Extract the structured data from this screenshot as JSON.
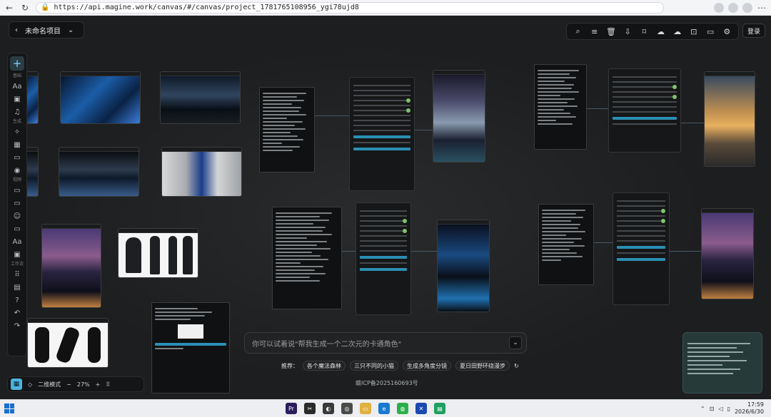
{
  "browser": {
    "url": "https://api.magine.work/canvas/#/canvas/project_1781765108956_ygi78ujd8"
  },
  "project": {
    "name": "未命名项目"
  },
  "topbar": {
    "login_label": "登录",
    "tools": [
      "search-icon",
      "list-icon",
      "trash-icon",
      "download-icon",
      "bookmark-icon",
      "cloud-upload-icon",
      "cloud-sync-icon",
      "export-icon",
      "folder-icon",
      "settings-icon"
    ]
  },
  "sidebar": {
    "sections": [
      {
        "label": "基础",
        "items": [
          "text-icon",
          "image-icon",
          "audio-icon"
        ]
      },
      {
        "label": "生成",
        "items": [
          "sparkle-icon",
          "frame-icon",
          "video-icon",
          "camera-icon"
        ]
      },
      {
        "label": "视频",
        "items": [
          "video-camera-icon",
          "video-icon",
          "people-icon",
          "film-icon",
          "text-icon",
          "image-edit-icon"
        ]
      },
      {
        "label": "工作流",
        "items": [
          "apps-icon",
          "save-icon",
          "help-icon",
          "undo-icon",
          "redo-icon"
        ]
      }
    ]
  },
  "chat": {
    "placeholder": "你可以试着说\"帮我生成一个二次元的卡通角色\"",
    "suggest_label": "推荐：",
    "suggestions": [
      "各个魔法森林",
      "三只不同的小猫",
      "生成多角度分镜",
      "夏日田野环绕漫步"
    ]
  },
  "icp_text": "赣ICP备2025160693号",
  "zoom": {
    "mode_label": "二维模式",
    "value": "27%"
  },
  "taskbar": {
    "time": "17:59",
    "date": "2026/6/30"
  },
  "colors": {
    "accent": "#4ab4e0",
    "canvas_bg": "#1d1e1f",
    "panel_bg": "#161718"
  }
}
